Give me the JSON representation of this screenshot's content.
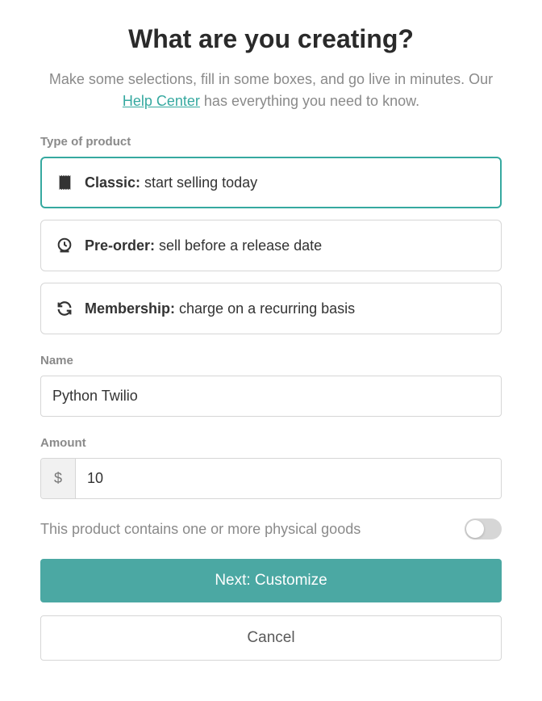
{
  "heading": "What are you creating?",
  "subheading_pre": "Make some selections, fill in some boxes, and go live in minutes. Our ",
  "help_link_text": "Help Center",
  "subheading_post": " has everything you need to know.",
  "type_label": "Type of product",
  "options": [
    {
      "title": "Classic:",
      "desc": " start selling today",
      "selected": true
    },
    {
      "title": "Pre-order:",
      "desc": " sell before a release date",
      "selected": false
    },
    {
      "title": "Membership:",
      "desc": " charge on a recurring basis",
      "selected": false
    }
  ],
  "name_label": "Name",
  "name_value": "Python Twilio",
  "amount_label": "Amount",
  "amount_prefix": "$",
  "amount_value": "10",
  "physical_goods_label": "This product contains one or more physical goods",
  "physical_goods_on": false,
  "next_button": "Next: Customize",
  "cancel_button": "Cancel",
  "colors": {
    "accent": "#36a9a0",
    "primary_button": "#4ba8a3"
  }
}
